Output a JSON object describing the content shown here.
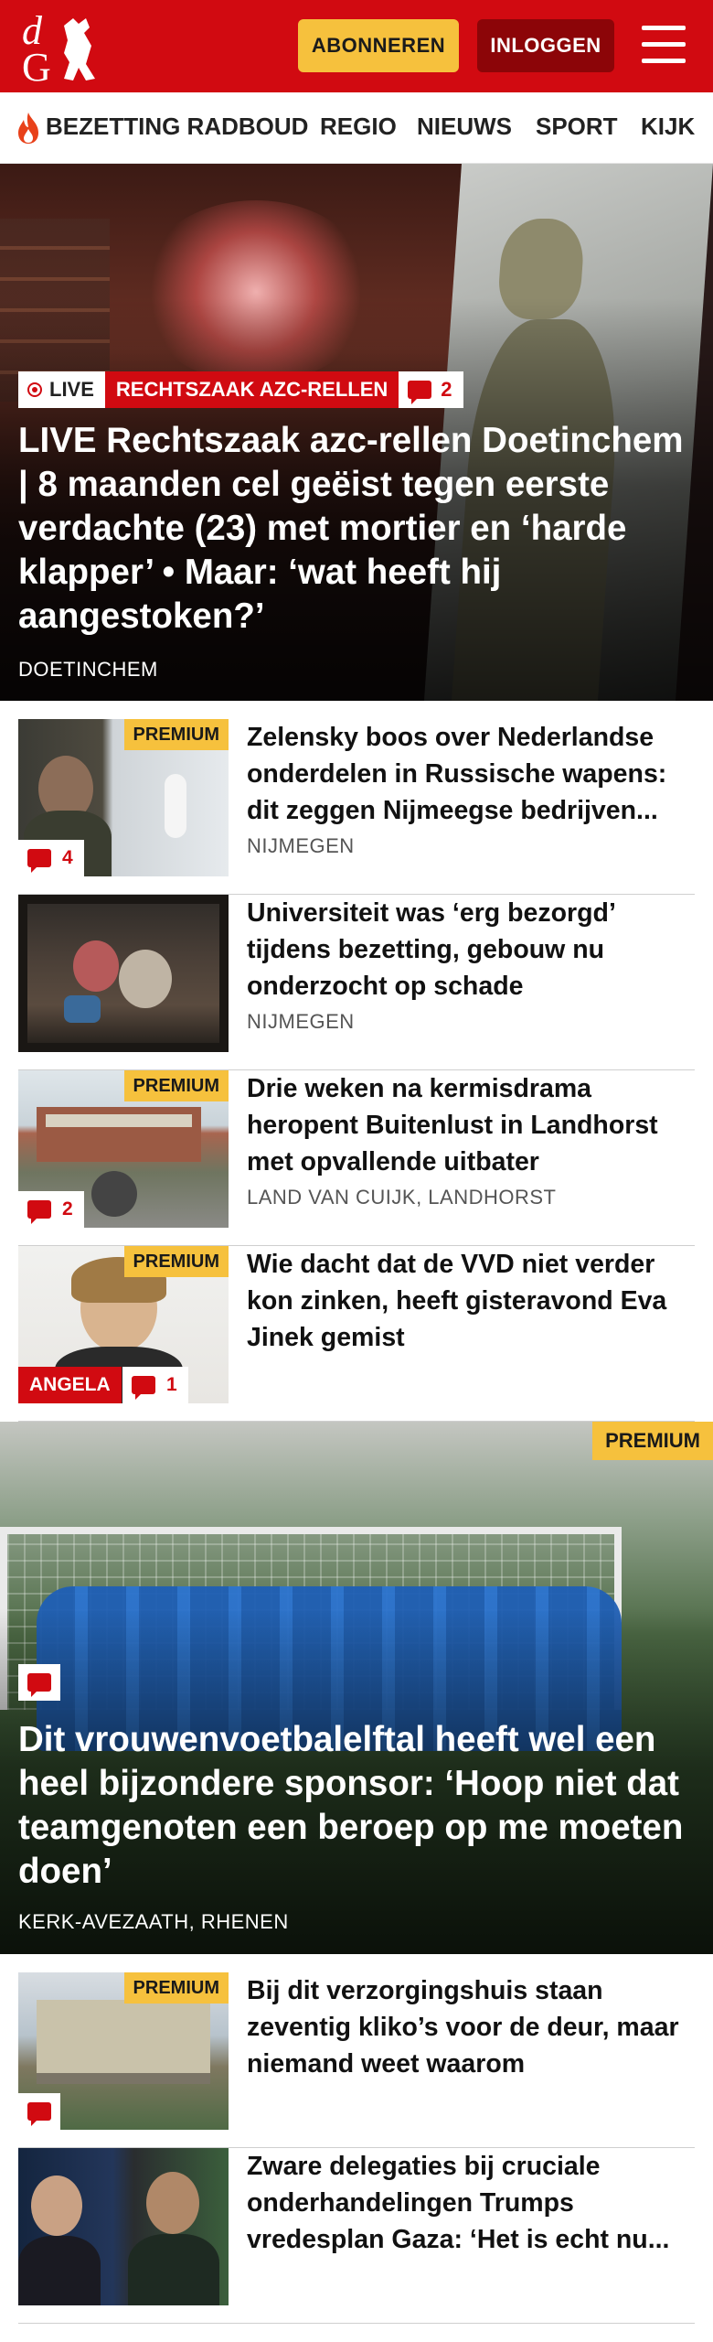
{
  "header": {
    "subscribe_label": "ABONNEREN",
    "login_label": "INLOGGEN",
    "brand_color": "#d10a11",
    "subscribe_color": "#f6c13d"
  },
  "nav": {
    "items": [
      {
        "label": "BEZETTING RADBOUD",
        "icon": "flame-icon"
      },
      {
        "label": "REGIO"
      },
      {
        "label": "NIEUWS"
      },
      {
        "label": "SPORT"
      },
      {
        "label": "KIJK"
      }
    ]
  },
  "hero": {
    "live_label": "LIVE",
    "topic": "RECHTSZAAK AZC-RELLEN",
    "comments": "2",
    "title": "LIVE Rechtszaak azc-rellen Doetinchem | 8 maanden cel geëist tegen eerste verdachte (23) met mortier en ‘harde klapper’ • Maar: ‘wat heeft hij aangestoken?’",
    "location": "DOETINCHEM"
  },
  "articles": [
    {
      "title": "Zelensky boos over Nederlandse onderdelen in Russische wapens: dit zeggen Nijmeegse bedrijven...",
      "location": "NIJMEGEN",
      "premium": "PREMIUM",
      "comments": "4"
    },
    {
      "title": "Universiteit was ‘erg bezorgd’ tijdens bezetting, gebouw nu onderzocht op schade",
      "location": "NIJMEGEN"
    },
    {
      "title": "Drie weken na kermisdrama heropent Buitenlust in Landhorst met opvallende uitbater",
      "location": "LAND VAN CUIJK, LANDHORST",
      "premium": "PREMIUM",
      "comments": "2"
    },
    {
      "title": "Wie dacht dat de VVD niet verder kon zinken, heeft gisteravond Eva Jinek gemist",
      "premium": "PREMIUM",
      "author": "ANGELA",
      "comments": "1"
    }
  ],
  "hero2": {
    "premium": "PREMIUM",
    "title": "Dit vrouwenvoetbalelftal heeft wel een heel bijzondere sponsor: ‘Hoop niet dat teamgenoten een beroep op me moeten doen’",
    "location": "KERK-AVEZAATH, RHENEN"
  },
  "articles2": [
    {
      "title": "Bij dit verzorgingshuis staan zeventig kliko’s voor de deur, maar niemand weet waarom",
      "premium": "PREMIUM"
    },
    {
      "title": "Zware delegaties bij cruciale onderhandelingen Trumps vredesplan Gaza: ‘Het is echt nu..."
    }
  ]
}
